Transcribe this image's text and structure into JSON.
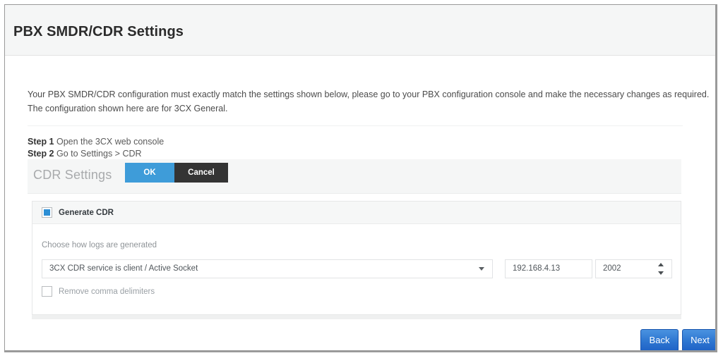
{
  "header": {
    "title": "PBX SMDR/CDR Settings"
  },
  "intro": {
    "line1": "Your PBX SMDR/CDR configuration must exactly match the settings shown below, please go to your PBX configuration console and make the necessary changes as required.",
    "line2": "The configuration shown here are for 3CX General."
  },
  "steps": [
    {
      "key": "Step 1",
      "text": "Open the 3CX web console"
    },
    {
      "key": "Step 2",
      "text": "Go to Settings > CDR"
    }
  ],
  "console": {
    "toolbar": {
      "title": "CDR Settings",
      "ok_label": "OK",
      "cancel_label": "Cancel"
    },
    "card": {
      "generate_cdr_label": "Generate CDR",
      "generate_cdr_checked": true,
      "select_field_label": "Choose how logs are generated",
      "log_mode_value": "3CX CDR service is client / Active Socket",
      "host_value": "192.168.4.13",
      "port_value": "2002",
      "remove_comma_label": "Remove comma delimiters",
      "remove_comma_checked": false
    }
  },
  "footer": {
    "back_label": "Back",
    "next_label": "Next"
  },
  "colors": {
    "accent_blue": "#3e9cd9",
    "cancel_dark": "#343434",
    "nav_blue": "#2f78d2",
    "checkbox_blue": "#2d8fd5"
  }
}
